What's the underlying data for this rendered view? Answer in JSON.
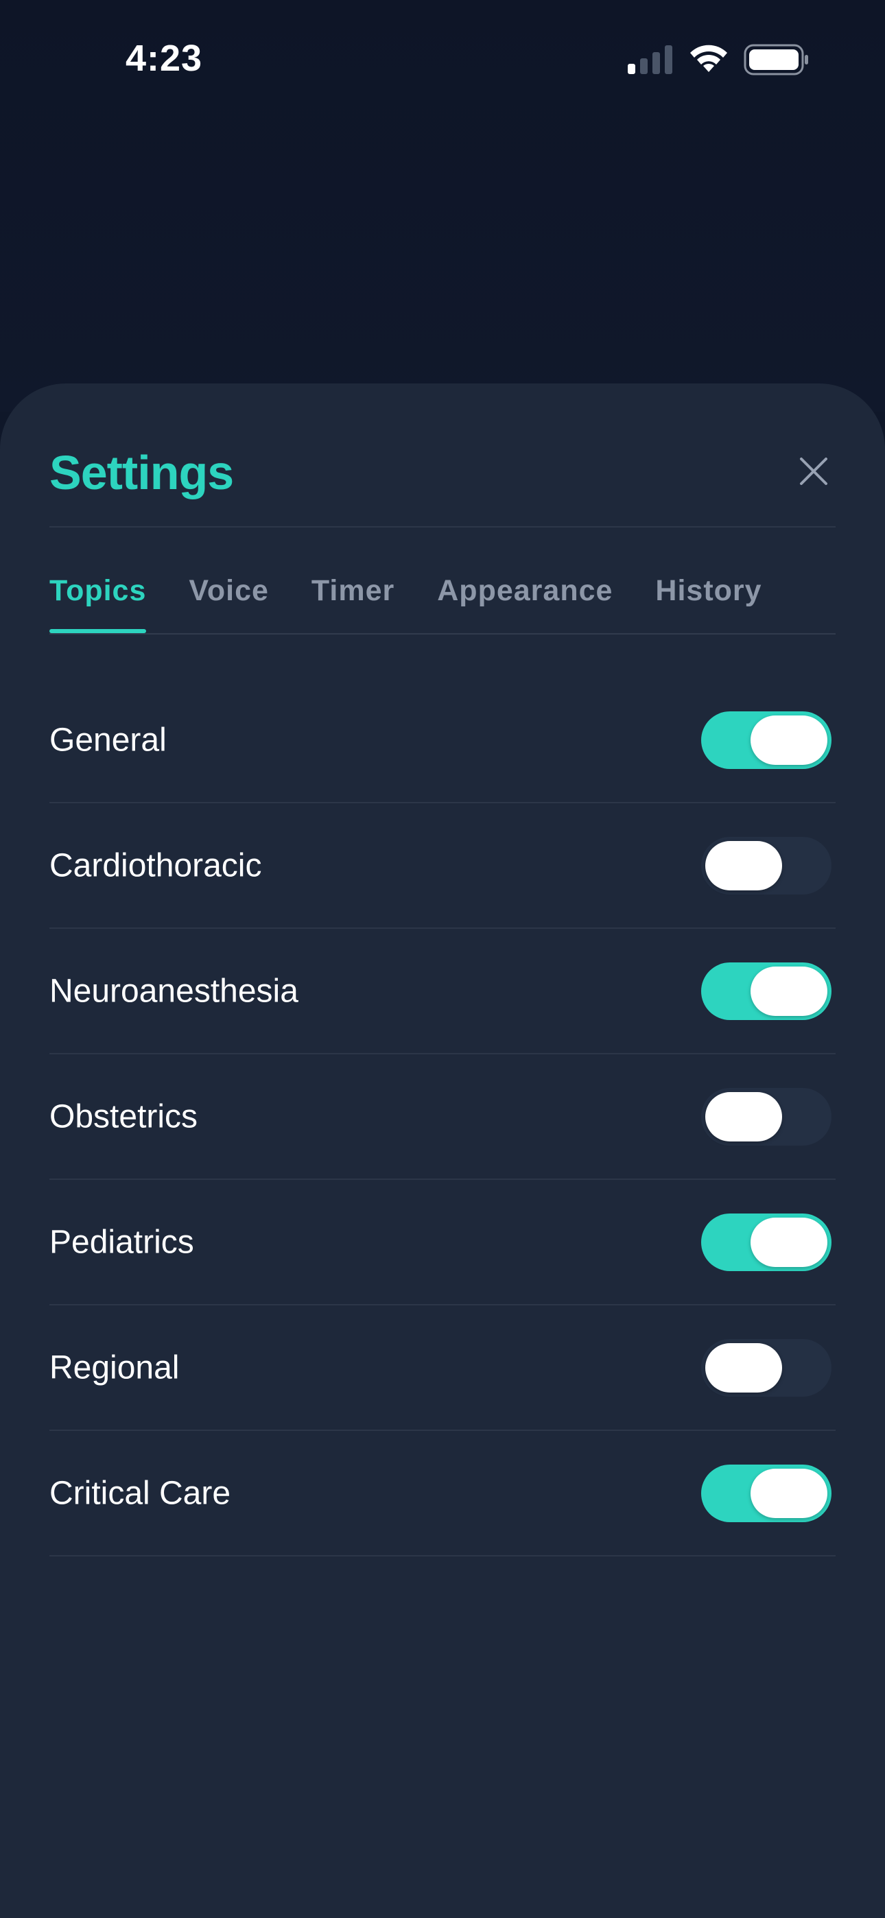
{
  "status_bar": {
    "time": "4:23",
    "signal_icon": "cellular-signal-icon",
    "wifi_icon": "wifi-icon",
    "battery_icon": "battery-icon"
  },
  "settings": {
    "title": "Settings",
    "close_icon": "close-icon",
    "tabs": [
      {
        "label": "Topics",
        "active": true
      },
      {
        "label": "Voice",
        "active": false
      },
      {
        "label": "Timer",
        "active": false
      },
      {
        "label": "Appearance",
        "active": false
      },
      {
        "label": "History",
        "active": false
      }
    ],
    "topics": [
      {
        "label": "General",
        "enabled": true
      },
      {
        "label": "Cardiothoracic",
        "enabled": false
      },
      {
        "label": "Neuroanesthesia",
        "enabled": true
      },
      {
        "label": "Obstetrics",
        "enabled": false
      },
      {
        "label": "Pediatrics",
        "enabled": true
      },
      {
        "label": "Regional",
        "enabled": false
      },
      {
        "label": "Critical Care",
        "enabled": true
      }
    ]
  },
  "colors": {
    "accent": "#2dd4bf",
    "sheet_background": "#1e283a",
    "page_background": "#0f1729",
    "toggle_off": "#243044",
    "tab_inactive": "#8d97a8"
  }
}
